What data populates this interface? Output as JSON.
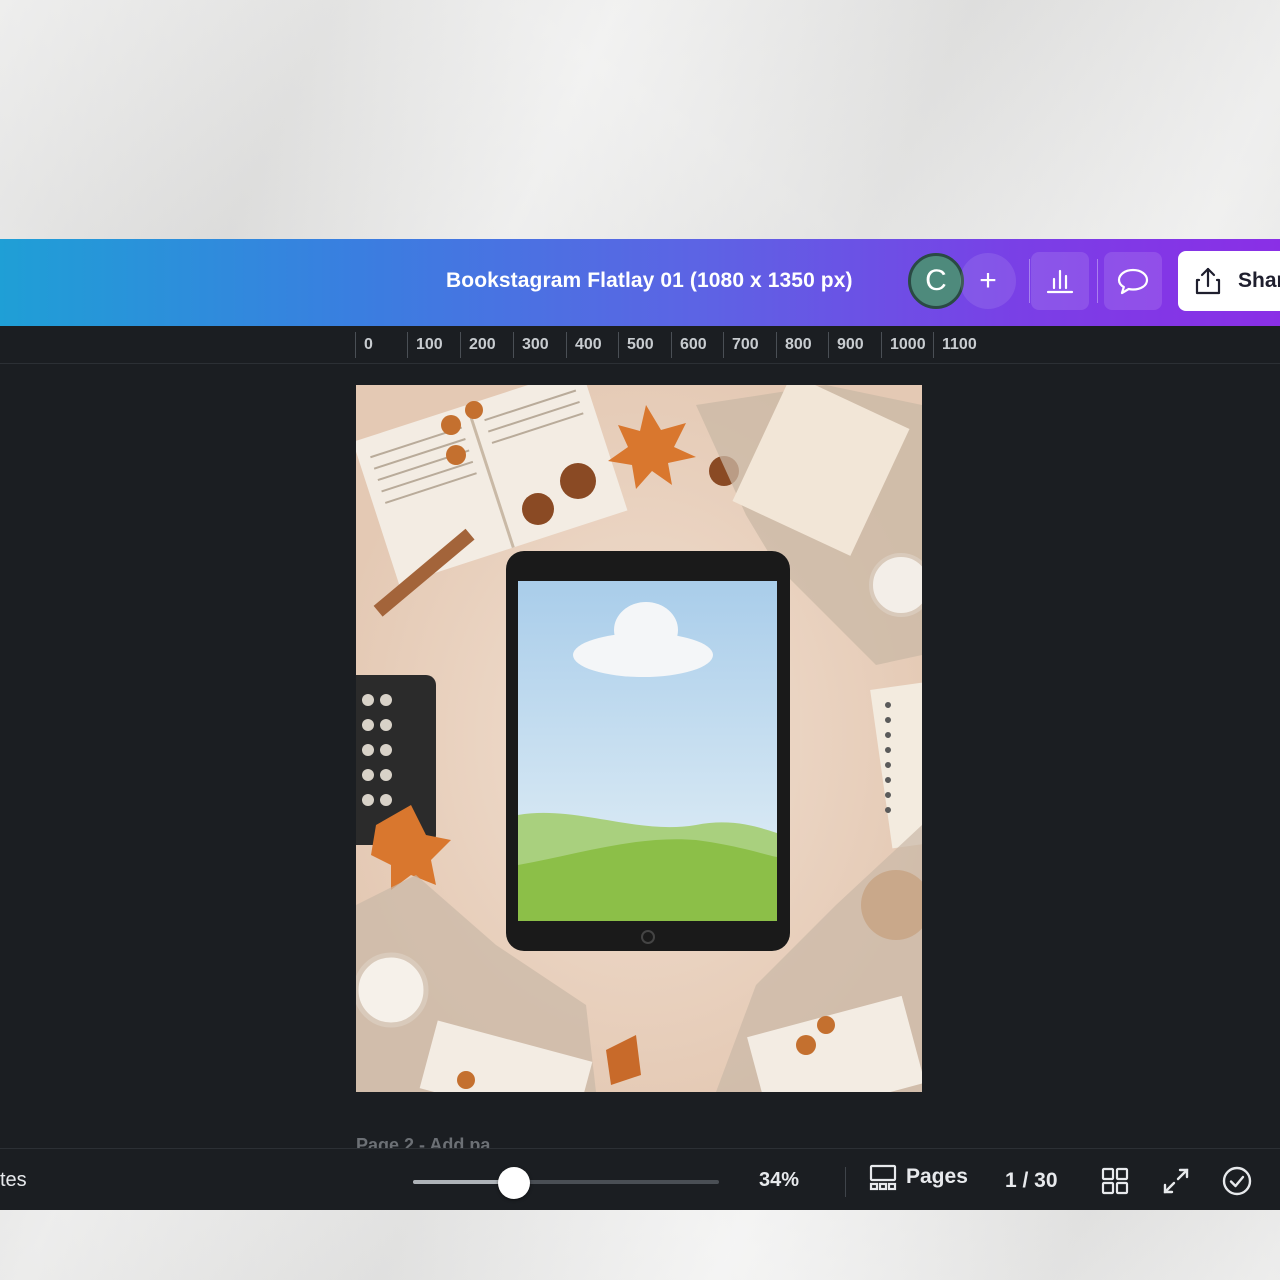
{
  "header": {
    "doc_title": "Bookstagram Flatlay 01 (1080 x 1350 px)",
    "avatar_initial": "C",
    "add_label": "+",
    "share_label": "Shar"
  },
  "ruler": {
    "ticks": [
      "0",
      "100",
      "200",
      "300",
      "400",
      "500",
      "600",
      "700",
      "800",
      "900",
      "1000",
      "1100"
    ]
  },
  "page2_label": "Page 2 - Add pa...",
  "footer": {
    "notes_label": "tes",
    "zoom_value": 34,
    "zoom_label": "34%",
    "pages_label": "Pages",
    "page_count": "1 / 30"
  },
  "colors": {
    "header_gradient_start": "#1f9fd6",
    "header_gradient_end": "#8a2fe6",
    "editor_background": "#1b1e22",
    "avatar": "#4e8a7c"
  },
  "icons": [
    "plus-icon",
    "insights-icon",
    "comment-icon",
    "share-icon",
    "pages-icon",
    "grid-view-icon",
    "fullscreen-icon",
    "check-circle-icon"
  ]
}
